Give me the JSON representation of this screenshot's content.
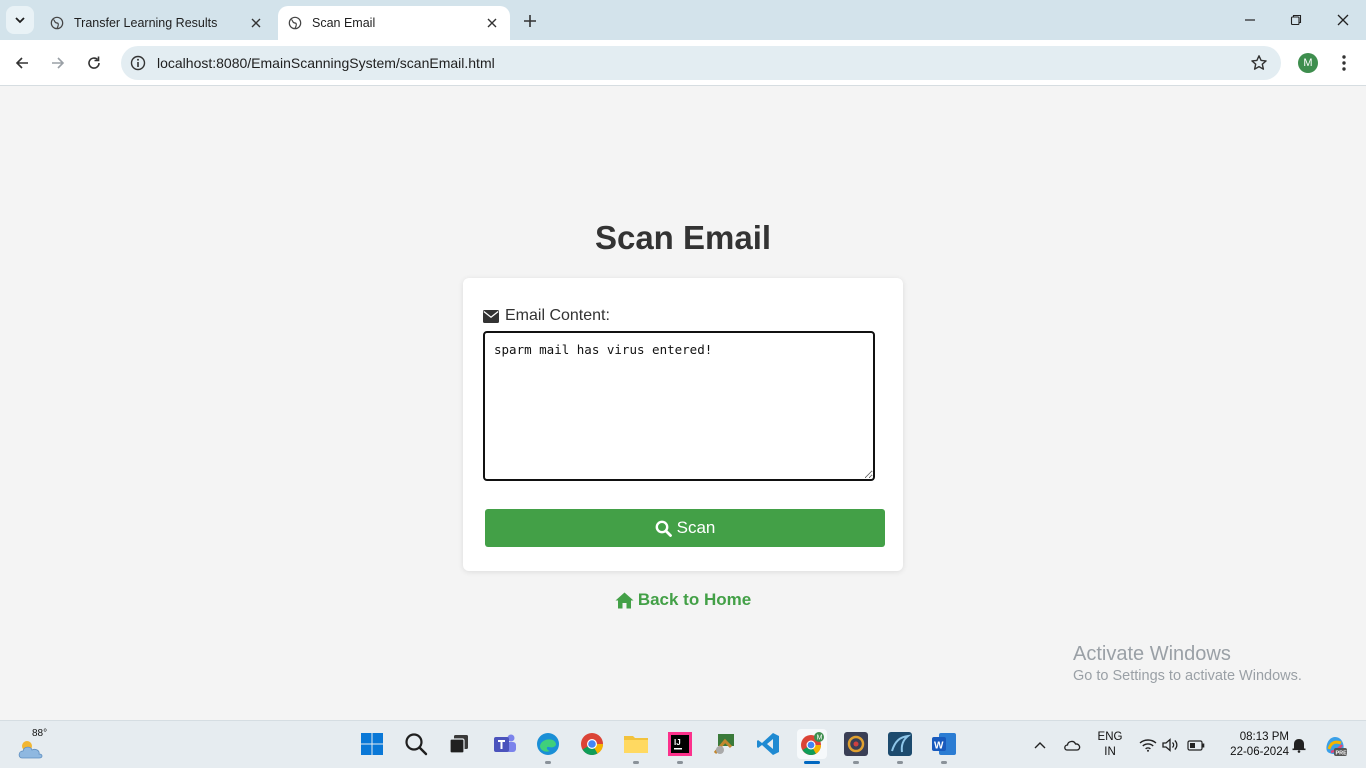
{
  "browser": {
    "tabs": [
      {
        "title": "Transfer Learning Results",
        "active": false
      },
      {
        "title": "Scan Email",
        "active": true
      }
    ],
    "address_bar": {
      "url": "localhost:8080/EmainScanningSystem/scanEmail.html"
    },
    "profile_initial": "M"
  },
  "page": {
    "title": "Scan Email",
    "form": {
      "label": "Email Content:",
      "textarea_value": "sparm mail has virus entered!",
      "submit_label": "Scan"
    },
    "back_link": "Back to Home"
  },
  "watermark": {
    "line1": "Activate Windows",
    "line2": "Go to Settings to activate Windows."
  },
  "taskbar": {
    "weather_temp": "88°",
    "apps": [
      "start-icon",
      "search-icon",
      "task-view-icon",
      "teams-icon",
      "edge-icon",
      "chrome-icon",
      "file-explorer-icon",
      "intellij-icon",
      "unknown-app-icon",
      "vscode-icon",
      "chrome-profile-icon",
      "app-icon",
      "mysql-workbench-icon",
      "word-icon"
    ],
    "language": {
      "line1": "ENG",
      "line2": "IN"
    },
    "clock": {
      "time": "08:13 PM",
      "date": "22-06-2024"
    }
  },
  "colors": {
    "accent_green": "#43a047",
    "tab_strip": "#d3e3eb",
    "page_background": "#f4f4f4"
  }
}
